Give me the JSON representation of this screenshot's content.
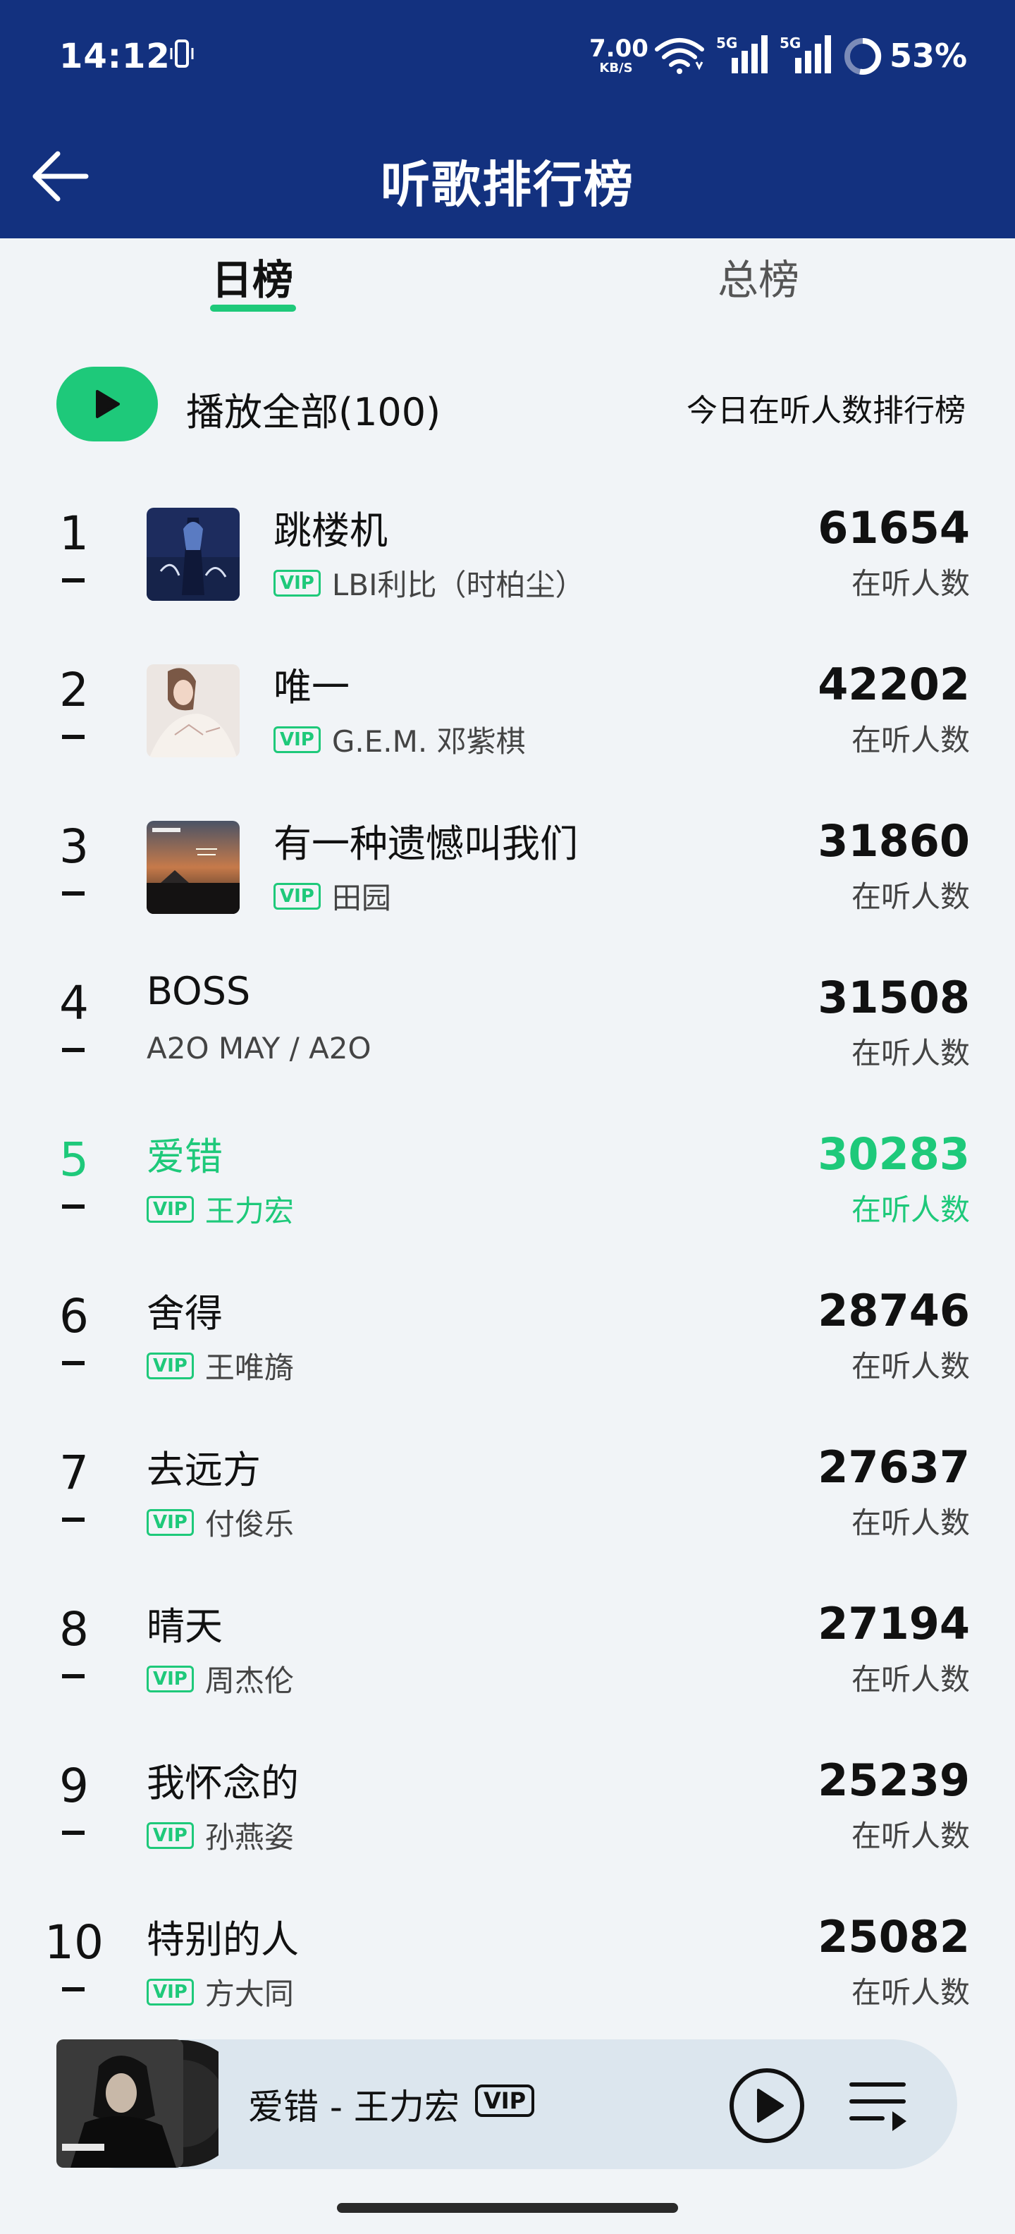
{
  "status_bar": {
    "time": "14:12",
    "net_speed_value": "7.00",
    "net_speed_unit": "KB/S",
    "signal_label": "5G",
    "battery": "53%"
  },
  "header": {
    "title": "听歌排行榜"
  },
  "tabs": [
    {
      "label": "日榜",
      "active": true
    },
    {
      "label": "总榜",
      "active": false
    }
  ],
  "play_all": {
    "label": "播放全部(100)"
  },
  "chart_description": "今日在听人数排行榜",
  "vip_badge": "VIP",
  "count_label": "在听人数",
  "songs": [
    {
      "rank": "1",
      "title": "跳楼机",
      "artist": "LBI利比（时柏尘）",
      "count": "61654",
      "vip": true,
      "cover": true
    },
    {
      "rank": "2",
      "title": "唯一",
      "artist": "G.E.M. 邓紫棋",
      "count": "42202",
      "vip": true,
      "cover": true
    },
    {
      "rank": "3",
      "title": "有一种遗憾叫我们",
      "artist": "田园",
      "count": "31860",
      "vip": true,
      "cover": true
    },
    {
      "rank": "4",
      "title": "BOSS",
      "artist": "A2O MAY / A2O",
      "count": "31508",
      "vip": false,
      "cover": false
    },
    {
      "rank": "5",
      "title": "爱错",
      "artist": "王力宏",
      "count": "30283",
      "vip": true,
      "cover": false,
      "playing": true
    },
    {
      "rank": "6",
      "title": "舍得",
      "artist": "王唯旖",
      "count": "28746",
      "vip": true,
      "cover": false
    },
    {
      "rank": "7",
      "title": "去远方",
      "artist": "付俊乐",
      "count": "27637",
      "vip": true,
      "cover": false
    },
    {
      "rank": "8",
      "title": "晴天",
      "artist": "周杰伦",
      "count": "27194",
      "vip": true,
      "cover": false
    },
    {
      "rank": "9",
      "title": "我怀念的",
      "artist": "孙燕姿",
      "count": "25239",
      "vip": true,
      "cover": false
    },
    {
      "rank": "10",
      "title": "特别的人",
      "artist": "方大同",
      "count": "25082",
      "vip": true,
      "cover": false
    }
  ],
  "player": {
    "now_playing": "爱错 - 王力宏",
    "vip": "VIP"
  },
  "colors": {
    "header_bg": "#13317f",
    "accent": "#1ec97a",
    "page_bg": "#f1f4f7",
    "player_bg": "#dce6ee"
  },
  "icons": [
    "back-arrow-icon",
    "play-icon",
    "play-circle-icon",
    "queue-list-icon",
    "wifi-icon",
    "signal-icon",
    "battery-icon",
    "vibrate-icon"
  ]
}
